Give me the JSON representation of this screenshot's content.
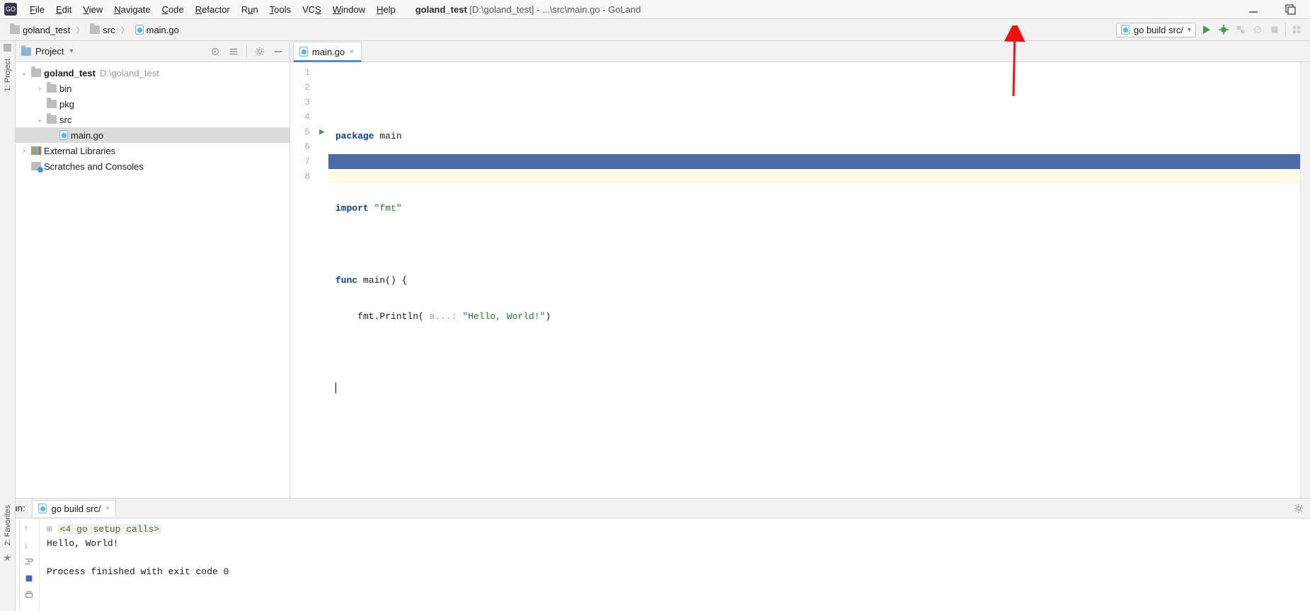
{
  "menubar": {
    "items": [
      "File",
      "Edit",
      "View",
      "Navigate",
      "Code",
      "Refactor",
      "Run",
      "Tools",
      "VCS",
      "Window",
      "Help"
    ],
    "title_project": "goland_test",
    "title_path": "[D:\\goland_test] - ...\\src\\main.go - GoLand"
  },
  "breadcrumbs": {
    "items": [
      "goland_test",
      "src",
      "main.go"
    ]
  },
  "toolbar": {
    "run_config_label": "go build src/"
  },
  "project": {
    "panel_label": "Project",
    "root_name": "goland_test",
    "root_path": "D:\\goland_test",
    "dirs": {
      "bin": "bin",
      "pkg": "pkg",
      "src": "src"
    },
    "file_main": "main.go",
    "external_libs": "External Libraries",
    "scratches": "Scratches and Consoles"
  },
  "left_stripe": {
    "label_project": "1: Project",
    "label_favorites": "2: Favorites"
  },
  "editor": {
    "tab_label": "main.go",
    "lines": {
      "l1_kw": "package",
      "l1_pkg": " main",
      "l3_kw": "import",
      "l3_str": " \"fmt\"",
      "l5_kw": "func",
      "l5_fn": " main() {",
      "l6_pre": "    fmt.Println( ",
      "l6_hint": "a...:",
      "l6_str": " \"Hello, World!\"",
      "l6_end": ")",
      "l7": "}"
    },
    "line_numbers": [
      "1",
      "2",
      "3",
      "4",
      "5",
      "6",
      "7",
      "8"
    ]
  },
  "run": {
    "label": "Run:",
    "tab_label": "go build src/",
    "console": {
      "setup": "<4 go setup calls>",
      "output": "Hello, World!",
      "exit": "Process finished with exit code 0"
    }
  }
}
